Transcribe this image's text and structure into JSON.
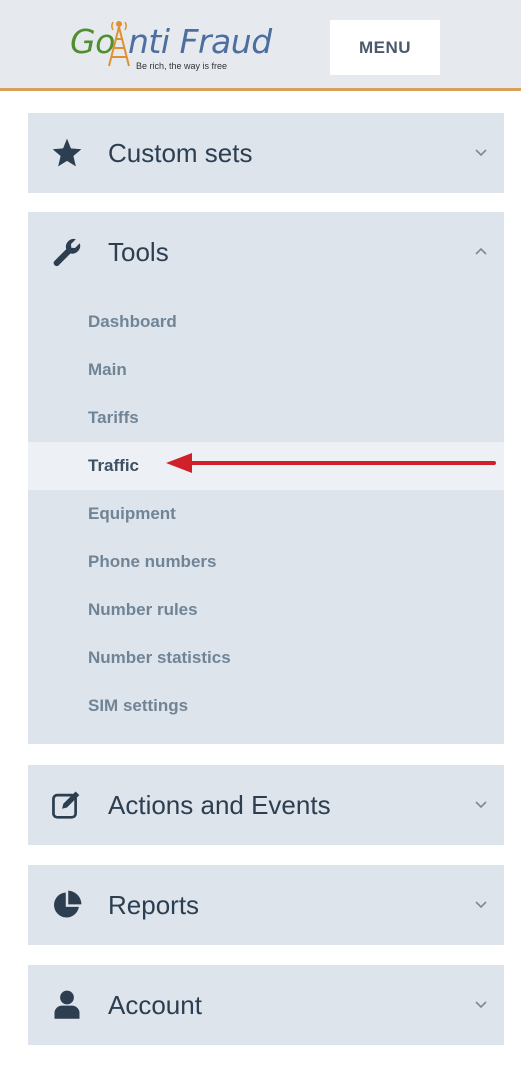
{
  "header": {
    "logo": {
      "part1": "Go",
      "part2": "nti Fraud",
      "tagline": "Be rich, the way is free"
    },
    "menu_label": "MENU"
  },
  "sidebar": {
    "sections": [
      {
        "label": "Custom sets",
        "icon": "star-icon",
        "expanded": false
      },
      {
        "label": "Tools",
        "icon": "wrench-icon",
        "expanded": true,
        "items": [
          {
            "label": "Dashboard"
          },
          {
            "label": "Main"
          },
          {
            "label": "Tariffs"
          },
          {
            "label": "Traffic",
            "highlighted": true
          },
          {
            "label": "Equipment"
          },
          {
            "label": "Phone numbers"
          },
          {
            "label": "Number rules"
          },
          {
            "label": "Number statistics"
          },
          {
            "label": "SIM settings"
          }
        ]
      },
      {
        "label": "Actions and Events",
        "icon": "edit-icon",
        "expanded": false
      },
      {
        "label": "Reports",
        "icon": "pie-chart-icon",
        "expanded": false
      },
      {
        "label": "Account",
        "icon": "user-icon",
        "expanded": false
      }
    ]
  },
  "annotation": {
    "type": "arrow",
    "points_to": "Traffic",
    "color": "#d0202a"
  },
  "colors": {
    "panel_bg": "#dde4ec",
    "header_bg": "#e6eaef",
    "accent_line": "#d9a05b",
    "text_dark": "#2c3e50",
    "submenu_text": "#718496",
    "logo_green": "#4f8f2e",
    "logo_blue": "#4d6e9e"
  }
}
